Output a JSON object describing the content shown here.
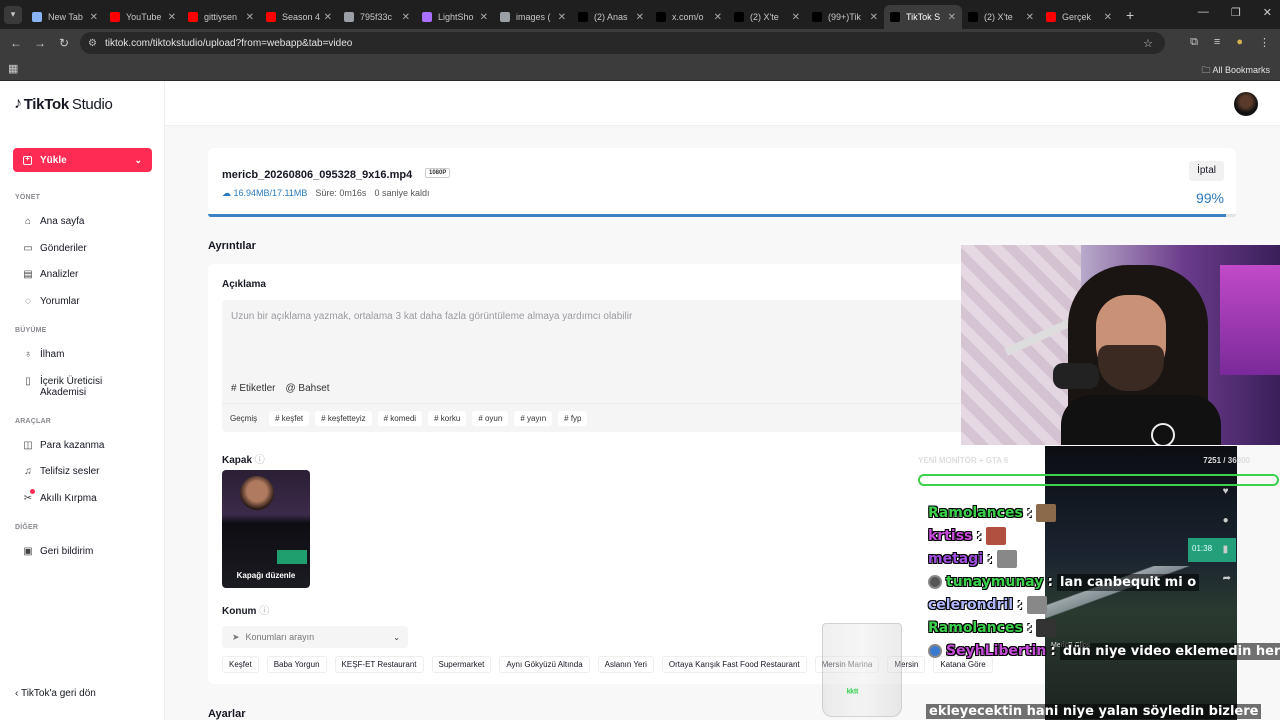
{
  "browser": {
    "tabs": [
      {
        "title": "New Tab",
        "color": "#8ab4f8",
        "active": false
      },
      {
        "title": "YouTube",
        "color": "#ff0000",
        "active": false
      },
      {
        "title": "gittiysen",
        "color": "#ff0000",
        "active": false
      },
      {
        "title": "Season 4",
        "color": "#ff0000",
        "active": false
      },
      {
        "title": "795f33c",
        "color": "#9aa0a6",
        "active": false
      },
      {
        "title": "LightSho",
        "color": "#a970ff",
        "active": false
      },
      {
        "title": "images (",
        "color": "#9aa0a6",
        "active": false
      },
      {
        "title": "(2) Anas",
        "color": "#000000",
        "active": false
      },
      {
        "title": "x.com/o",
        "color": "#000000",
        "active": false
      },
      {
        "title": "(2) X'te",
        "color": "#000000",
        "active": false
      },
      {
        "title": "(99+)Tik",
        "color": "#000000",
        "active": false
      },
      {
        "title": "TikTok S",
        "color": "#000000",
        "active": true
      },
      {
        "title": "(2) X'te",
        "color": "#000000",
        "active": false
      },
      {
        "title": "Gerçek",
        "color": "#ff0000",
        "active": false
      }
    ],
    "url": "tiktok.com/tiktokstudio/upload?from=webapp&tab=video",
    "all_bookmarks": "All Bookmarks"
  },
  "sidebar": {
    "logo_brand": "TikTok",
    "logo_suffix": "Studio",
    "upload_label": "Yükle",
    "sections": {
      "manage": "YÖNET",
      "growth": "BÜYÜME",
      "tools": "ARAÇLAR",
      "other": "DİĞER"
    },
    "items": {
      "home": "Ana sayfa",
      "posts": "Gönderiler",
      "analytics": "Analizler",
      "comments": "Yorumlar",
      "inspiration": "İlham",
      "academy_1": "İçerik Üreticisi",
      "academy_2": "Akademisi",
      "monetization": "Para kazanma",
      "sounds": "Telifsiz sesler",
      "smart_cut": "Akıllı Kırpma",
      "feedback": "Geri bildirim"
    },
    "back_link": "TikTok'a geri dön"
  },
  "upload": {
    "file_name": "mericb_20260806_095328_9x16.mp4",
    "resolution": "1080P",
    "size": "16.94MB/17.11MB",
    "duration": "Süre: 0m16s",
    "remaining": "0 saniye kaldı",
    "cancel_label": "İptal",
    "progress_text": "99%",
    "progress_fraction": 0.99
  },
  "details": {
    "title": "Ayrıntılar",
    "description_label": "Açıklama",
    "description_placeholder": "Uzun bir açıklama yazmak, ortalama 3 kat daha fazla görüntüleme almaya yardımcı olabilir",
    "tags_button": "# Etiketler",
    "mention_button": "@ Bahset",
    "history_label": "Geçmiş",
    "hashtags": [
      "# keşfet",
      "# keşfetteyiz",
      "# komedi",
      "# korku",
      "# oyun",
      "# yayın",
      "# fyp"
    ],
    "cover_label": "Kapak",
    "cover_edit": "Kapağı düzenle",
    "location_label": "Konum",
    "location_placeholder": "Konumları arayın",
    "locations": [
      "Keşfet",
      "Baba Yorgun",
      "KEŞF-ET Restaurant",
      "Supermarket",
      "Aynı Gökyüzü Altında",
      "Aslanın Yeri",
      "Ortaya Karışık Fast Food Restaurant",
      "Mersin Marina",
      "Mersin",
      "Katana Göre"
    ],
    "settings_title": "Ayarlar"
  },
  "overlay": {
    "top_left": "YENİ MONİTÖR + GTA 6",
    "top_right": "7251 / 36000",
    "clip_caption": "Kick.com/MericB",
    "clip_author": "MericB Clips",
    "clip_time": "01:38",
    "chat": [
      {
        "name": "Ramolances",
        "color": "#3bd14a",
        "message": ""
      },
      {
        "name": "krtiss",
        "color": "#c64bd9",
        "message": ""
      },
      {
        "name": "metagi",
        "color": "#a04fe0",
        "message": ""
      },
      {
        "name": "tunaymunay",
        "color": "#3bd14a",
        "message": "lan canbequit mi o"
      },
      {
        "name": "celerondril",
        "color": "#b0b8ff",
        "message": ""
      },
      {
        "name": "Ramolances",
        "color": "#3bd14a",
        "message": ""
      },
      {
        "name": "SeyhLibertin",
        "color": "#c64bd9",
        "message": "dün niye video eklemedin her gün"
      }
    ],
    "chat_continuation": "ekleyecektin hani niye yalan söyledin bizlere"
  }
}
